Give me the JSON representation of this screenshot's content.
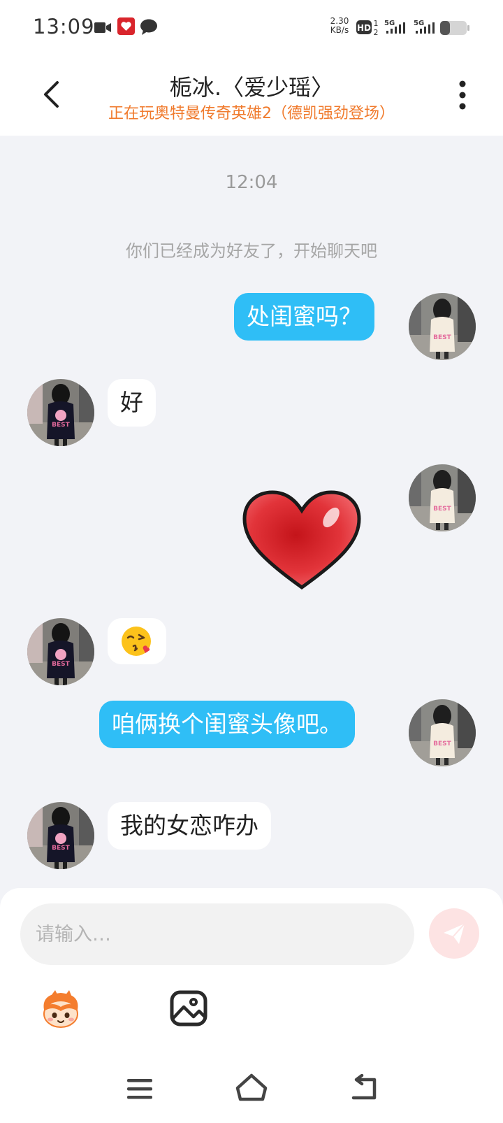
{
  "status_bar": {
    "time": "13:09",
    "net_speed_value": "2.30",
    "net_speed_unit": "KB/s",
    "icons": [
      "video-icon",
      "app-icon",
      "chat-icon",
      "hd-icon",
      "5g-signal-icon",
      "5g-signal-icon",
      "battery-icon"
    ]
  },
  "header": {
    "title": "栀冰.〈爱少瑶〉",
    "subtitle": "正在玩奥特曼传奇英雄2（德凯强劲登场）",
    "back_icon": "chevron-left-icon",
    "more_icon": "more-vertical-icon"
  },
  "chat": {
    "timestamp": "12:04",
    "system_message": "你们已经成为好友了，开始聊天吧",
    "messages": [
      {
        "from": "me",
        "type": "text",
        "text": "处闺蜜吗？"
      },
      {
        "from": "them",
        "type": "text",
        "text": "好"
      },
      {
        "from": "me",
        "type": "sticker",
        "sticker": "red-heart"
      },
      {
        "from": "them",
        "type": "emoji",
        "text": "😘"
      },
      {
        "from": "me",
        "type": "text",
        "text": "咱俩换个闺蜜头像吧。"
      },
      {
        "from": "them",
        "type": "text",
        "text": "我的女恋咋办"
      }
    ]
  },
  "input": {
    "placeholder": "请输入…",
    "send_icon": "send-icon"
  },
  "toolbar": {
    "icons": [
      "mascot-icon",
      "image-icon"
    ]
  },
  "nav_bar": {
    "icons": [
      "menu-icon",
      "home-icon",
      "back-icon"
    ]
  },
  "colors": {
    "my_bubble": "#2fbef6",
    "their_bubble": "#ffffff",
    "chat_bg": "#f2f3f7",
    "subtitle": "#f07a2c",
    "send_button_bg": "#fde3e3"
  }
}
